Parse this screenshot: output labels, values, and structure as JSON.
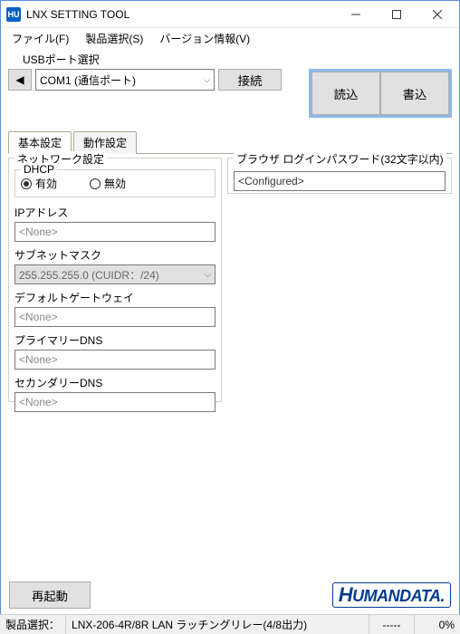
{
  "window": {
    "title": "LNX SETTING TOOL",
    "icon_text": "HU"
  },
  "menu": {
    "file": "ファイル(F)",
    "product": "製品選択(S)",
    "version": "バージョン情報(V)"
  },
  "toolbar": {
    "usb_label": "USBポート選択",
    "nav_prev": "◀",
    "com_select": "COM1 (通信ポート)",
    "connect": "接続",
    "read": "読込",
    "write": "書込"
  },
  "tabs": {
    "basic": "基本設定",
    "action": "動作設定"
  },
  "network": {
    "legend": "ネットワーク設定",
    "dhcp": {
      "legend": "DHCP",
      "enable": "有効",
      "disable": "無効",
      "selected": "enable"
    },
    "ip": {
      "label": "IPアドレス",
      "value": "<None>"
    },
    "subnet": {
      "label": "サブネットマスク",
      "value": "255.255.255.0 (CUIDR：/24)"
    },
    "gateway": {
      "label": "デフォルトゲートウェイ",
      "value": "<None>"
    },
    "dns1": {
      "label": "プライマリーDNS",
      "value": "<None>"
    },
    "dns2": {
      "label": "セカンダリーDNS",
      "value": "<None>"
    }
  },
  "browser_pw": {
    "legend": "ブラウザ ログインパスワード(32文字以内)",
    "value": "<Configured>"
  },
  "bottom": {
    "reboot": "再起動",
    "logo_h": "H",
    "logo_rest": "UMANDATA",
    "logo_dot": "."
  },
  "status": {
    "label": "製品選択：",
    "product": "LNX-206-4R/8R LAN ラッチングリレー(4/8出力)",
    "dash": "-----",
    "pct": "0%"
  }
}
